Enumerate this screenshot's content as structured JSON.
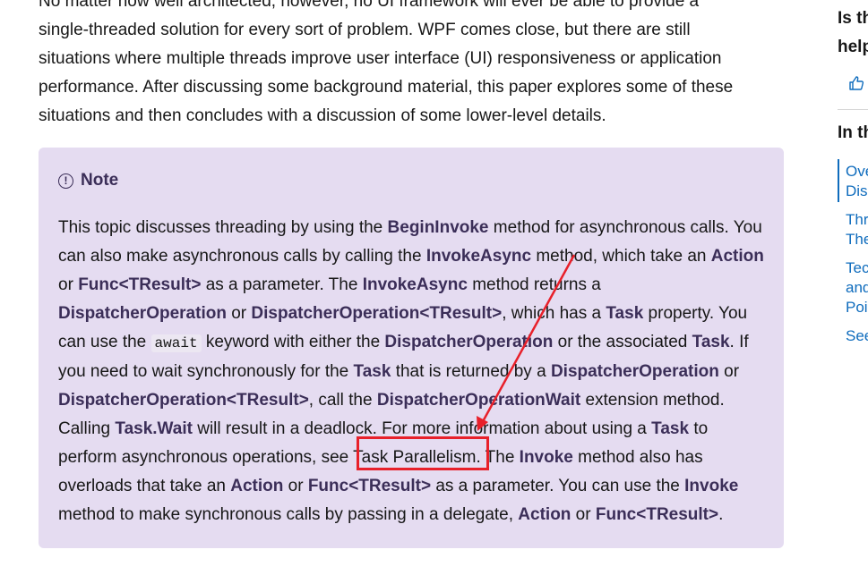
{
  "intro": {
    "lines": [
      "No matter how well architected, however, no UI framework will ever be able to provide a",
      "single-threaded solution for every sort of problem. WPF comes close, but there are still",
      "situations where multiple threads improve user interface (UI) responsiveness or application",
      "performance. After discussing some background material, this paper explores some of these",
      "situations and then concludes with a discussion of some lower-level details."
    ]
  },
  "note": {
    "icon": "info-circle-icon",
    "title": "Note",
    "t1": "This topic discusses threading by using the ",
    "b1": "BeginInvoke",
    "t2": " method for asynchronous calls. You can also make asynchronous calls by calling the ",
    "b2": "InvokeAsync",
    "t3": " method, which take an ",
    "b3": "Action",
    "t4": " or ",
    "b4": "Func<TResult>",
    "t5": " as a parameter. The ",
    "b5": "InvokeAsync",
    "t6": " method returns a ",
    "b6": "DispatcherOperation",
    "t7": " or ",
    "b7": "DispatcherOperation<TResult>",
    "t8": ", which has a ",
    "b8": "Task",
    "t9": " property. You can use the ",
    "code1": "await",
    "t10": " keyword with either the ",
    "b9": "DispatcherOperation",
    "t11": " or the associated ",
    "b10": "Task",
    "t12": ". If you need to wait synchronously for the ",
    "b11": "Task",
    "t13": " that is returned by a ",
    "b12": "DispatcherOperation",
    "t14": " or ",
    "b13": "DispatcherOperation<TResult>",
    "t15": ", call the ",
    "b14": "DispatcherOperationWait",
    "t16": " extension method. Calling ",
    "b15": "Task.Wait",
    "t17": " will result in a deadlock. For more information about using a ",
    "b16": "Task",
    "t18": " to perform asynchronous operations, see ",
    "link1": "Task Parallelism",
    "t19": ". The ",
    "b17": "Invoke",
    "t20": " method also has overloads that take an ",
    "b18": "Action",
    "t21": " or ",
    "b19": "Func<TResult>",
    "t22": " as a parameter. You can use the ",
    "b20": "Invoke",
    "t23": " method to make synchronous calls by passing in a delegate, ",
    "b21": "Action",
    "t24": " or ",
    "b22": "Func<TResult>",
    "t25": "."
  },
  "annotation": {
    "box_color": "#e8202a",
    "arrow_color": "#e8202a"
  },
  "rail": {
    "q_line1": "Is th",
    "q_line2": "help",
    "like_icon": "thumbs-up-icon",
    "heading": "In th",
    "links": [
      "Ove",
      "Dis",
      "Thr",
      "The",
      "Tec",
      "and",
      "Poi",
      "See"
    ]
  },
  "colors": {
    "note_bg": "#e5dcf1",
    "accent": "#0f6cbd",
    "note_title": "#3b2e58"
  }
}
